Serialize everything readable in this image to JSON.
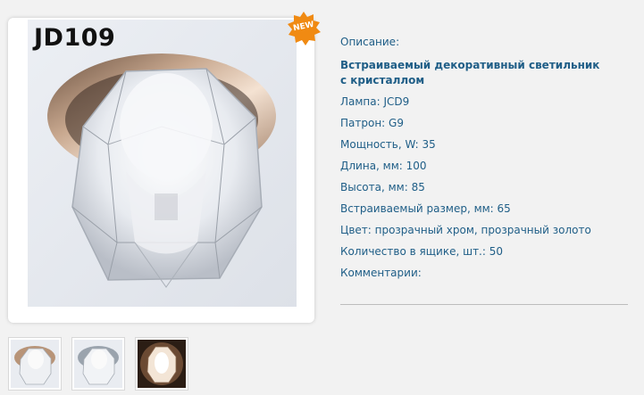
{
  "product": {
    "code": "JD109",
    "badge": "NEW"
  },
  "specs": {
    "description_label": "Описание:",
    "title": "Встраиваемый декоративный светильник с кристаллом",
    "lamp": "Лампа: JCD9",
    "socket": "Патрон: G9",
    "power": "Мощность, W: 35",
    "length": "Длина, мм: 100",
    "height": "Высота, мм: 85",
    "cutout": "Встраиваемый размер, мм: 65",
    "color": "Цвет: прозрачный хром, прозрачный золото",
    "box_qty": "Количество в ящике, шт.: 50",
    "comments": "Комментарии:"
  },
  "thumbnails": [
    {
      "name": "gold-variant"
    },
    {
      "name": "chrome-variant"
    },
    {
      "name": "lit-variant"
    }
  ],
  "colors": {
    "link_blue": "#1f5e87",
    "badge_orange": "#f08a12",
    "background": "#f2f2f2"
  }
}
